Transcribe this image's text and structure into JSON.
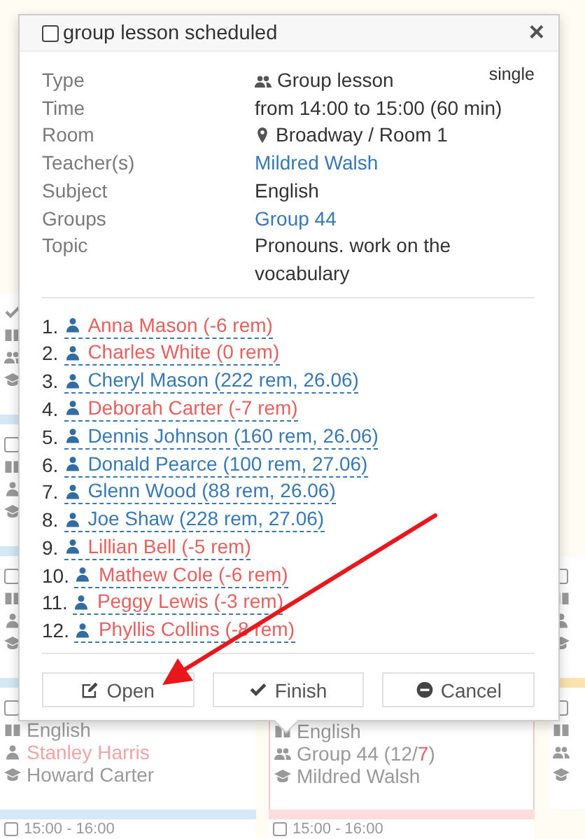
{
  "background": {
    "columns": [
      {
        "cards": [
          {
            "done": true,
            "kind": "group",
            "color": "#d4e9f5"
          },
          {
            "done": false,
            "kind": "single",
            "color": "#d4e9f5"
          },
          {
            "done": false,
            "kind": "single",
            "color": "#d4e9f5"
          },
          {
            "done": false,
            "kind": "single",
            "color": "#d4e9f5",
            "subject": "English",
            "student": "Stanley Harris",
            "teacher": "Howard Carter"
          }
        ],
        "next_time": "15:00 - 16:00",
        "next_done": false
      },
      {
        "cards": [
          {
            "kind": "group",
            "color": "#fcdcdc",
            "subject": "English",
            "group_parts": [
              {
                "text": "Group 44 (12/",
                "kind": "plain"
              },
              {
                "text": "7",
                "kind": "alert"
              },
              {
                "text": ")",
                "kind": "plain"
              }
            ],
            "teacher": "Mildred Walsh"
          }
        ],
        "next_time": "15:00 - 16:00",
        "next_done": false
      },
      {
        "cards": [
          {
            "done": false,
            "kind": "single",
            "color": "#fbe3b0"
          },
          {
            "done": false,
            "kind": "group"
          }
        ]
      }
    ]
  },
  "popup": {
    "done": false,
    "title": "group lesson scheduled",
    "close": "×",
    "badge": "single",
    "fields": [
      {
        "label": "Type",
        "value": "Group lesson",
        "kind": "type"
      },
      {
        "label": "Time",
        "value": "from 14:00 to 15:00 (60 min)",
        "kind": "plain"
      },
      {
        "label": "Room",
        "value": "Broadway / Room 1",
        "kind": "place"
      },
      {
        "label": "Teacher(s)",
        "value": "Mildred Walsh",
        "kind": "link"
      },
      {
        "label": "Subject",
        "value": "English",
        "kind": "plain"
      },
      {
        "label": "Groups",
        "value": "Group 44",
        "kind": "link"
      },
      {
        "label": "Topic",
        "value": "Pronouns. work on the vocabulary",
        "kind": "plain"
      }
    ],
    "students": [
      {
        "number": "1.",
        "name": "Anna Mason (-6 rem)",
        "color": "#e8605e"
      },
      {
        "number": "2.",
        "name": "Charles White (0 rem)",
        "color": "#e8605e"
      },
      {
        "number": "3.",
        "name": "Cheryl Mason (222 rem, 26.06)",
        "color": "#3779b6"
      },
      {
        "number": "4.",
        "name": "Deborah Carter (-7 rem)",
        "color": "#e8605e"
      },
      {
        "number": "5.",
        "name": "Dennis Johnson (160 rem, 26.06)",
        "color": "#3779b6"
      },
      {
        "number": "6.",
        "name": "Donald Pearce (100 rem, 27.06)",
        "color": "#3779b6"
      },
      {
        "number": "7.",
        "name": "Glenn Wood (88 rem, 26.06)",
        "color": "#3779b6"
      },
      {
        "number": "8.",
        "name": "Joe Shaw (228 rem, 27.06)",
        "color": "#3779b6"
      },
      {
        "number": "9.",
        "name": "Lillian Bell (-5 rem)",
        "color": "#e8605e"
      },
      {
        "number": "10.",
        "name": "Mathew Cole (-6 rem)",
        "color": "#e8605e"
      },
      {
        "number": "11.",
        "name": "Peggy Lewis (-3 rem)",
        "color": "#e8605e"
      },
      {
        "number": "12.",
        "name": "Phyllis Collins (-8 rem)",
        "color": "#e8605e"
      }
    ],
    "buttons": [
      {
        "label": "Open",
        "kind": "open"
      },
      {
        "label": "Finish",
        "kind": "finish"
      },
      {
        "label": "Cancel",
        "kind": "cancel"
      }
    ]
  },
  "annotation": {
    "kind": "arrow"
  }
}
